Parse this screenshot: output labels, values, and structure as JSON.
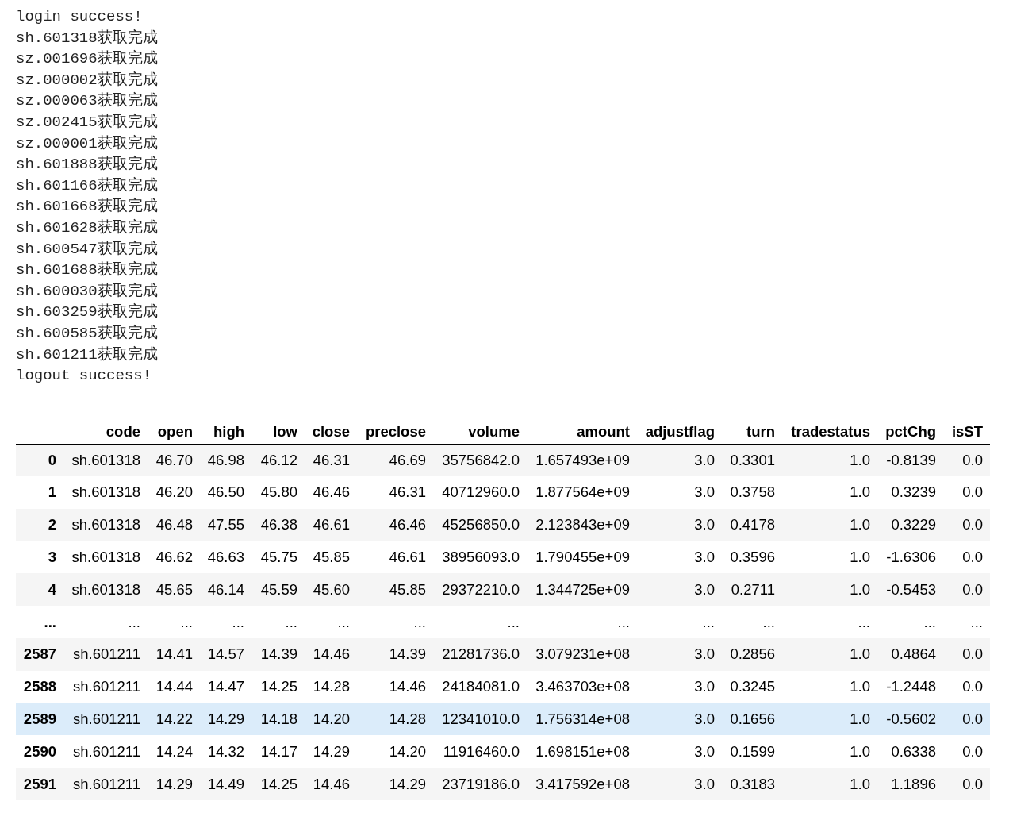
{
  "log_lines": [
    "login success!",
    "sh.601318获取完成",
    "sz.001696获取完成",
    "sz.000002获取完成",
    "sz.000063获取完成",
    "sz.002415获取完成",
    "sz.000001获取完成",
    "sh.601888获取完成",
    "sh.601166获取完成",
    "sh.601668获取完成",
    "sh.601628获取完成",
    "sh.600547获取完成",
    "sh.601688获取完成",
    "sh.600030获取完成",
    "sh.603259获取完成",
    "sh.600585获取完成",
    "sh.601211获取完成",
    "logout success!"
  ],
  "table": {
    "columns": [
      "",
      "code",
      "open",
      "high",
      "low",
      "close",
      "preclose",
      "volume",
      "amount",
      "adjustflag",
      "turn",
      "tradestatus",
      "pctChg",
      "isST"
    ],
    "rows": [
      {
        "highlighted": false,
        "cells": [
          "0",
          "sh.601318",
          "46.70",
          "46.98",
          "46.12",
          "46.31",
          "46.69",
          "35756842.0",
          "1.657493e+09",
          "3.0",
          "0.3301",
          "1.0",
          "-0.8139",
          "0.0"
        ]
      },
      {
        "highlighted": false,
        "cells": [
          "1",
          "sh.601318",
          "46.20",
          "46.50",
          "45.80",
          "46.46",
          "46.31",
          "40712960.0",
          "1.877564e+09",
          "3.0",
          "0.3758",
          "1.0",
          "0.3239",
          "0.0"
        ]
      },
      {
        "highlighted": false,
        "cells": [
          "2",
          "sh.601318",
          "46.48",
          "47.55",
          "46.38",
          "46.61",
          "46.46",
          "45256850.0",
          "2.123843e+09",
          "3.0",
          "0.4178",
          "1.0",
          "0.3229",
          "0.0"
        ]
      },
      {
        "highlighted": false,
        "cells": [
          "3",
          "sh.601318",
          "46.62",
          "46.63",
          "45.75",
          "45.85",
          "46.61",
          "38956093.0",
          "1.790455e+09",
          "3.0",
          "0.3596",
          "1.0",
          "-1.6306",
          "0.0"
        ]
      },
      {
        "highlighted": false,
        "cells": [
          "4",
          "sh.601318",
          "45.65",
          "46.14",
          "45.59",
          "45.60",
          "45.85",
          "29372210.0",
          "1.344725e+09",
          "3.0",
          "0.2711",
          "1.0",
          "-0.5453",
          "0.0"
        ]
      },
      {
        "highlighted": false,
        "cells": [
          "...",
          "...",
          "...",
          "...",
          "...",
          "...",
          "...",
          "...",
          "...",
          "...",
          "...",
          "...",
          "...",
          "..."
        ]
      },
      {
        "highlighted": false,
        "cells": [
          "2587",
          "sh.601211",
          "14.41",
          "14.57",
          "14.39",
          "14.46",
          "14.39",
          "21281736.0",
          "3.079231e+08",
          "3.0",
          "0.2856",
          "1.0",
          "0.4864",
          "0.0"
        ]
      },
      {
        "highlighted": false,
        "cells": [
          "2588",
          "sh.601211",
          "14.44",
          "14.47",
          "14.25",
          "14.28",
          "14.46",
          "24184081.0",
          "3.463703e+08",
          "3.0",
          "0.3245",
          "1.0",
          "-1.2448",
          "0.0"
        ]
      },
      {
        "highlighted": true,
        "cells": [
          "2589",
          "sh.601211",
          "14.22",
          "14.29",
          "14.18",
          "14.20",
          "14.28",
          "12341010.0",
          "1.756314e+08",
          "3.0",
          "0.1656",
          "1.0",
          "-0.5602",
          "0.0"
        ]
      },
      {
        "highlighted": false,
        "cells": [
          "2590",
          "sh.601211",
          "14.24",
          "14.32",
          "14.17",
          "14.29",
          "14.20",
          "11916460.0",
          "1.698151e+08",
          "3.0",
          "0.1599",
          "1.0",
          "0.6338",
          "0.0"
        ]
      },
      {
        "highlighted": false,
        "cells": [
          "2591",
          "sh.601211",
          "14.29",
          "14.49",
          "14.25",
          "14.46",
          "14.29",
          "23719186.0",
          "3.417592e+08",
          "3.0",
          "0.3183",
          "1.0",
          "1.1896",
          "0.0"
        ]
      }
    ]
  }
}
